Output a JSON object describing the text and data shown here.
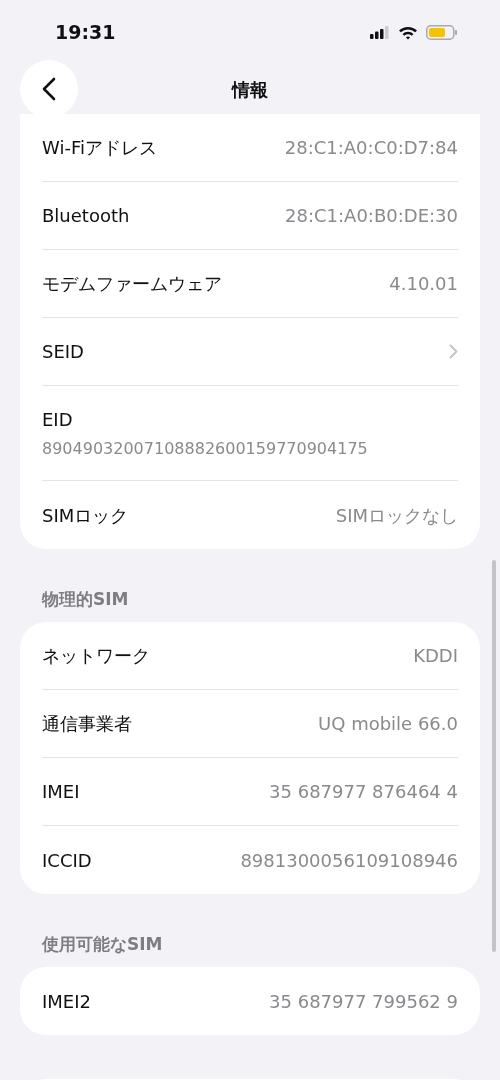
{
  "status_bar": {
    "time": "19:31"
  },
  "nav": {
    "title": "情報"
  },
  "sections": [
    {
      "rows": [
        {
          "kind": "value",
          "label": "Wi-Fiアドレス",
          "value": "28:C1:A0:C0:D7:84"
        },
        {
          "kind": "value",
          "label": "Bluetooth",
          "value": "28:C1:A0:B0:DE:30"
        },
        {
          "kind": "value",
          "label": "モデムファームウェア",
          "value": "4.10.01"
        },
        {
          "kind": "chevron",
          "label": "SEID"
        },
        {
          "kind": "stacked",
          "label": "EID",
          "value": "89049032007108882600159770904175"
        },
        {
          "kind": "value",
          "label": "SIMロック",
          "value": "SIMロックなし"
        }
      ]
    },
    {
      "header": "物理的SIM",
      "rows": [
        {
          "kind": "value",
          "label": "ネットワーク",
          "value": "KDDI"
        },
        {
          "kind": "value",
          "label": "通信事業者",
          "value": "UQ mobile 66.0"
        },
        {
          "kind": "value",
          "label": "IMEI",
          "value": "35 687977 876464 4"
        },
        {
          "kind": "value",
          "label": "ICCID",
          "value": "8981300056109108946"
        }
      ]
    },
    {
      "header": "使用可能なSIM",
      "rows": [
        {
          "kind": "value",
          "label": "IMEI2",
          "value": "35 687977 799562 9"
        }
      ]
    }
  ]
}
